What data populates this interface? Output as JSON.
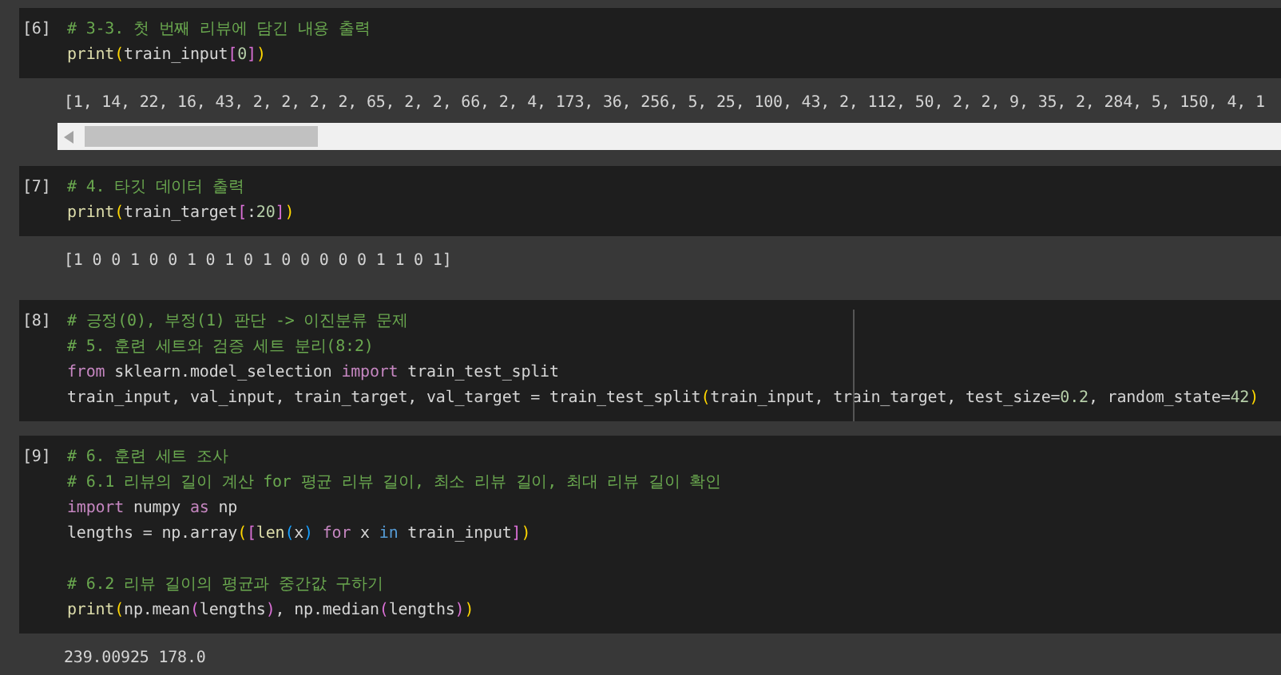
{
  "cells": [
    {
      "prompt": "[6]",
      "focused": false,
      "blocks": [
        [
          [
            {
              "kind": "comment",
              "text": "# 3-3. 첫 번째 리뷰에 담긴 내용 출력"
            }
          ],
          [
            {
              "kind": "function",
              "text": "print"
            },
            {
              "kind": "bracket1",
              "text": "("
            },
            {
              "kind": "plain",
              "text": "train_input"
            },
            {
              "kind": "bracket2",
              "text": "["
            },
            {
              "kind": "number",
              "text": "0"
            },
            {
              "kind": "bracket2",
              "text": "]"
            },
            {
              "kind": "bracket1",
              "text": ")"
            }
          ]
        ]
      ],
      "output": {
        "text": "[1, 14, 22, 16, 43, 2, 2, 2, 2, 65, 2, 2, 66, 2, 4, 173, 36, 256, 5, 25, 100, 43, 2, 112, 50, 2, 2, 9, 35, 2, 284, 5, 150, 4, 1",
        "horizontal_scrollbar": true
      }
    },
    {
      "prompt": "[7]",
      "focused": false,
      "blocks": [
        [
          [
            {
              "kind": "comment",
              "text": "# 4. 타깃 데이터 출력"
            }
          ],
          [
            {
              "kind": "function",
              "text": "print"
            },
            {
              "kind": "bracket1",
              "text": "("
            },
            {
              "kind": "plain",
              "text": "train_target"
            },
            {
              "kind": "bracket2",
              "text": "["
            },
            {
              "kind": "plain",
              "text": ":"
            },
            {
              "kind": "number",
              "text": "20"
            },
            {
              "kind": "bracket2",
              "text": "]"
            },
            {
              "kind": "bracket1",
              "text": ")"
            }
          ]
        ]
      ],
      "output": {
        "text": "[1 0 0 1 0 0 1 0 1 0 1 0 0 0 0 0 1 1 0 1]",
        "horizontal_scrollbar": false
      }
    },
    {
      "prompt": "[8]",
      "focused": true,
      "blocks": [
        [
          [
            {
              "kind": "comment",
              "text": "# 긍정(0), 부정(1) 판단 -> 이진분류 문제"
            }
          ],
          [
            {
              "kind": "comment",
              "text": "# 5. 훈련 세트와 검증 세트 분리(8:2)"
            }
          ],
          [
            {
              "kind": "keyword",
              "text": "from"
            },
            {
              "kind": "plain",
              "text": " sklearn.model_selection "
            },
            {
              "kind": "keyword",
              "text": "import"
            },
            {
              "kind": "plain",
              "text": " train_test_split"
            }
          ],
          [
            {
              "kind": "plain",
              "text": "train_input, val_input, train_target, val_target = train_test_split"
            },
            {
              "kind": "bracket1",
              "text": "("
            },
            {
              "kind": "plain",
              "text": "train_input, train_target, test_size="
            },
            {
              "kind": "number",
              "text": "0.2"
            },
            {
              "kind": "plain",
              "text": ", random_state="
            },
            {
              "kind": "number",
              "text": "42"
            },
            {
              "kind": "bracket1",
              "text": ")"
            }
          ]
        ]
      ]
    },
    {
      "prompt": "[9]",
      "focused": false,
      "blocks": [
        [
          [
            {
              "kind": "comment",
              "text": "# 6. 훈련 세트 조사"
            }
          ],
          [
            {
              "kind": "comment",
              "text": "# 6.1 리뷰의 길이 계산 for 평균 리뷰 길이, 최소 리뷰 길이, 최대 리뷰 길이 확인"
            }
          ],
          [
            {
              "kind": "keyword",
              "text": "import"
            },
            {
              "kind": "plain",
              "text": " numpy "
            },
            {
              "kind": "keyword",
              "text": "as"
            },
            {
              "kind": "plain",
              "text": " np"
            }
          ],
          [
            {
              "kind": "plain",
              "text": "lengths = np.array"
            },
            {
              "kind": "bracket1",
              "text": "("
            },
            {
              "kind": "bracket2",
              "text": "["
            },
            {
              "kind": "function",
              "text": "len"
            },
            {
              "kind": "bracket3",
              "text": "("
            },
            {
              "kind": "plain",
              "text": "x"
            },
            {
              "kind": "bracket3",
              "text": ")"
            },
            {
              "kind": "keyword",
              "text": " for"
            },
            {
              "kind": "plain",
              "text": " x "
            },
            {
              "kind": "operator",
              "text": "in"
            },
            {
              "kind": "plain",
              "text": " train_input"
            },
            {
              "kind": "bracket2",
              "text": "]"
            },
            {
              "kind": "bracket1",
              "text": ")"
            }
          ]
        ],
        [
          [
            {
              "kind": "comment",
              "text": "# 6.2 리뷰 길이의 평균과 중간값 구하기"
            }
          ],
          [
            {
              "kind": "function",
              "text": "print"
            },
            {
              "kind": "bracket1",
              "text": "("
            },
            {
              "kind": "plain",
              "text": "np.mean"
            },
            {
              "kind": "bracket2",
              "text": "("
            },
            {
              "kind": "plain",
              "text": "lengths"
            },
            {
              "kind": "bracket2",
              "text": ")"
            },
            {
              "kind": "plain",
              "text": ", np.median"
            },
            {
              "kind": "bracket2",
              "text": "("
            },
            {
              "kind": "plain",
              "text": "lengths"
            },
            {
              "kind": "bracket2",
              "text": ")"
            },
            {
              "kind": "bracket1",
              "text": ")"
            }
          ]
        ]
      ],
      "output": {
        "text": "239.00925 178.0"
      }
    }
  ]
}
